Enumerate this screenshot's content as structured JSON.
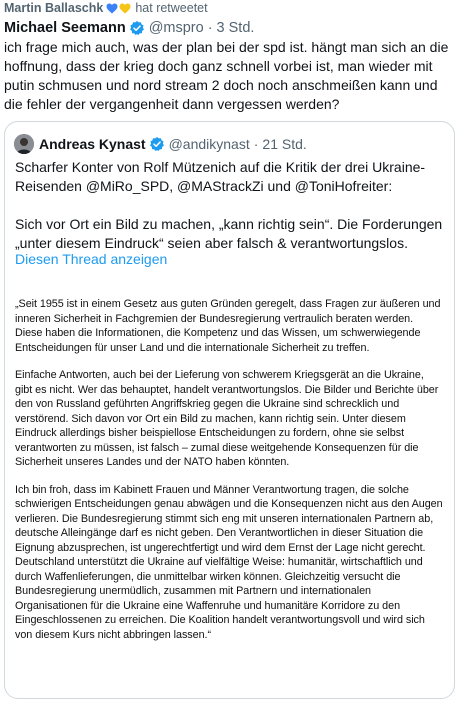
{
  "retweet": {
    "user": "Martin Ballaschk",
    "action": "hat retweetet",
    "heart_colors": [
      "#3b82f6",
      "#f5c518"
    ]
  },
  "tweet": {
    "author_name": "Michael Seemann",
    "handle": "@mspro",
    "separator": "·",
    "time": "3 Std.",
    "text": "ich frage mich auch, was der plan bei der spd ist. hängt man sich an die hoffnung, dass der krieg doch ganz schnell vorbei ist, man wieder mit putin schmusen und nord stream 2 doch noch anschmeißen kann und die fehler der vergangenheit dann vergessen werden?"
  },
  "quote": {
    "author_name": "Andreas Kynast",
    "handle": "@andikynast",
    "separator": "·",
    "time": "21 Std.",
    "paragraph1": "Scharfer Konter von Rolf Mützenich auf die Kritik der drei Ukraine-Reisenden @MiRo_SPD, @MAStrackZi und @ToniHofreiter:",
    "paragraph2": "Sich vor Ort ein Bild zu machen, „kann richtig sein“. Die Forderungen „unter diesem Eindruck“ seien aber falsch & verantwortungslos.",
    "show_thread": "Diesen Thread anzeigen"
  },
  "statement": {
    "p1": "„Seit 1955 ist in einem Gesetz aus guten Gründen geregelt, dass Fragen zur äußeren und inneren Sicherheit in Fachgremien der Bundesregierung vertraulich beraten werden. Diese haben die Informationen, die Kompetenz und das Wissen, um schwerwiegende Entscheidungen für unser Land und die internationale Sicherheit zu treffen.",
    "p2": "Einfache Antworten, auch bei der Lieferung von schwerem Kriegsgerät an die Ukraine, gibt es nicht. Wer das behauptet, handelt verantwortungslos. Die Bilder und Berichte über den von Russland geführten Angriffskrieg gegen die Ukraine sind schrecklich und verstörend. Sich davon vor Ort ein Bild zu machen, kann richtig sein. Unter diesem Eindruck allerdings bisher beispiellose Entscheidungen zu fordern, ohne sie selbst verantworten zu müssen, ist falsch – zumal diese weitgehende Konsequenzen für die Sicherheit unseres Landes und der NATO haben könnten.",
    "p3": "Ich bin froh, dass im Kabinett Frauen und Männer Verantwortung tragen, die solche schwierigen Entscheidungen genau abwägen und die Konsequenzen nicht aus den Augen verlieren. Die Bundesregierung stimmt sich eng mit unseren internationalen Partnern ab, deutsche Alleingänge darf es nicht geben. Den Verantwortlichen in dieser Situation die Eignung abzusprechen, ist ungerechtfertigt und wird dem Ernst der Lage nicht gerecht. Deutschland unterstützt die Ukraine auf vielfältige Weise: humanitär, wirtschaftlich und durch Waffenlieferungen, die unmittelbar wirken können. Gleichzeitig versucht die Bundesregierung unermüdlich, zusammen mit Partnern und internationalen Organisationen für die Ukraine eine Waffenruhe und humanitäre Korridore zu den Eingeschlossenen zu erreichen. Die Koalition handelt verantwortungsvoll und wird sich von diesem Kurs nicht abbringen lassen.“"
  },
  "colors": {
    "link": "#1d9bf0",
    "muted": "#536471",
    "verified": "#1d9bf0",
    "border": "#cfd9de"
  }
}
